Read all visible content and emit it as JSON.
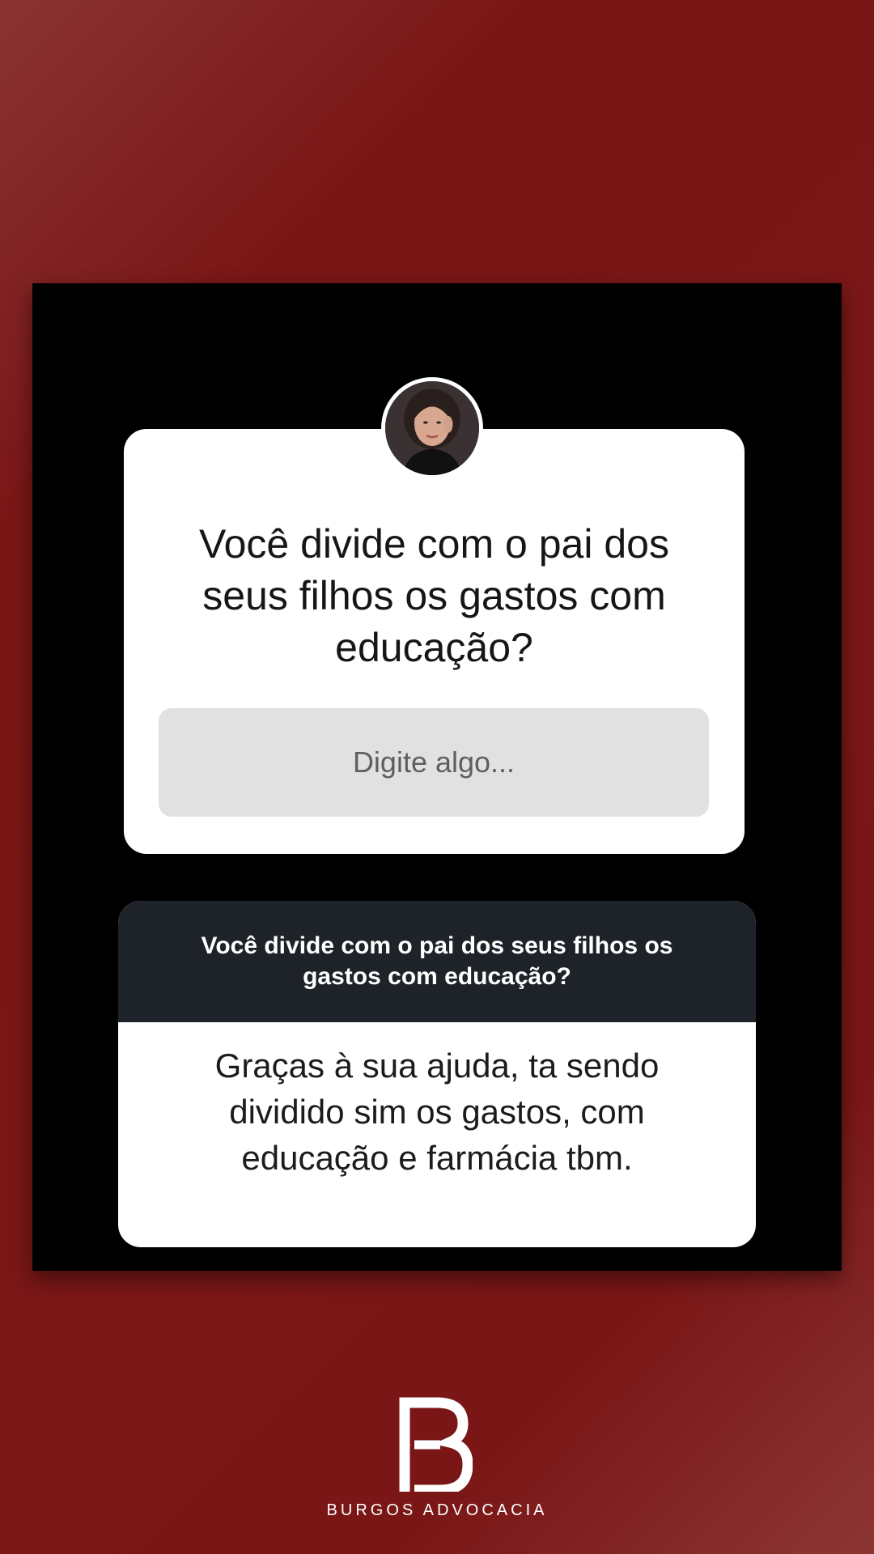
{
  "question_sticker": {
    "question": "Você divide com o pai dos seus filhos os gastos com educação?",
    "input_placeholder": "Digite algo..."
  },
  "response_card": {
    "question": "Você divide com o pai dos seus filhos os gastos com educação?",
    "answer": "Graças à sua ajuda, ta sendo dividido sim os gastos, com educação e farmácia tbm."
  },
  "brand": {
    "name": "BURGOS ADVOCACIA",
    "logo_text": "B",
    "logo_icon": "burgos-monogram-icon"
  },
  "colors": {
    "background": "#7b1717",
    "card_background": "#000000",
    "response_header": "#1e2329",
    "input_background": "#e1e1e1"
  }
}
